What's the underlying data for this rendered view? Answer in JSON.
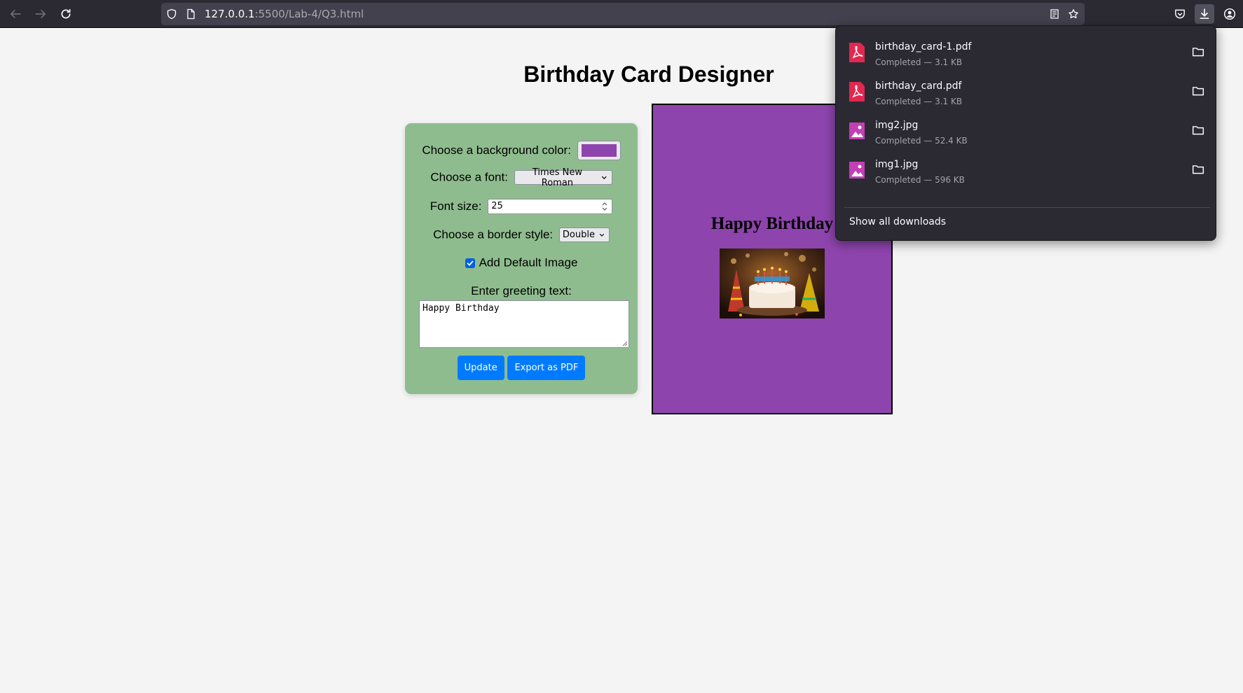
{
  "browser": {
    "url_host": "127.0.0.1",
    "url_path": ":5500/Lab-4/Q3.html",
    "icons": [
      "back-icon",
      "forward-icon",
      "reload-icon",
      "shield-icon",
      "page-icon",
      "reader-mode-icon",
      "bookmark-star-icon",
      "pocket-icon",
      "download-icon",
      "account-icon"
    ]
  },
  "page": {
    "title": "Birthday Card Designer"
  },
  "form": {
    "bg_color_label": "Choose a background color:",
    "bg_color_value": "#8e44ad",
    "font_label": "Choose a font:",
    "font_value": "Times New Roman",
    "font_size_label": "Font size:",
    "font_size_value": "25",
    "border_label": "Choose a border style:",
    "border_value": "Double",
    "default_image_label": "Add Default Image",
    "default_image_checked": true,
    "greeting_label": "Enter greeting text:",
    "greeting_value": "Happy Birthday",
    "update_label": "Update",
    "export_label": "Export as PDF"
  },
  "card": {
    "background": "#8e44ad",
    "text": "Happy Birthday"
  },
  "downloads": {
    "items": [
      {
        "name": "birthday_card-1.pdf",
        "status": "Completed — 3.1 KB",
        "type": "pdf"
      },
      {
        "name": "birthday_card.pdf",
        "status": "Completed — 3.1 KB",
        "type": "pdf"
      },
      {
        "name": "img2.jpg",
        "status": "Completed — 52.4 KB",
        "type": "image"
      },
      {
        "name": "img1.jpg",
        "status": "Completed — 596 KB",
        "type": "image"
      }
    ],
    "show_all_label": "Show all downloads"
  },
  "colors": {
    "panel_green": "#8fbc8f",
    "card_purple": "#8e44ad",
    "button_blue": "#007bff",
    "chrome_dark": "#2b2a33"
  }
}
